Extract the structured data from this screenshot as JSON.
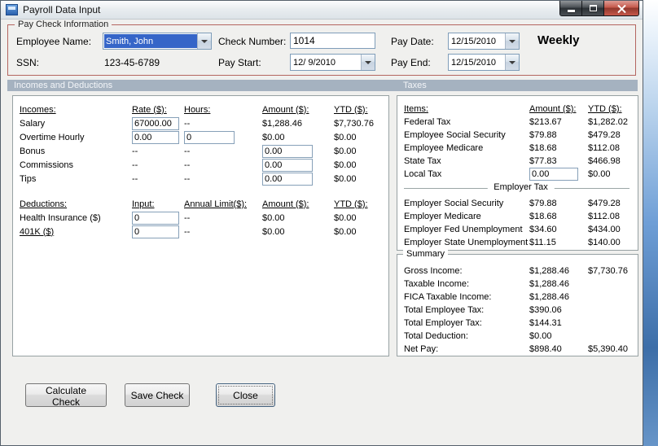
{
  "window": {
    "title": "Payroll Data Input"
  },
  "paycheck": {
    "group_label": "Pay Check Information",
    "fields": {
      "employee_name": {
        "label": "Employee Name:",
        "value": "Smith, John"
      },
      "ssn": {
        "label": "SSN:",
        "value": "123-45-6789"
      },
      "check_number": {
        "label": "Check Number:",
        "value": "1014"
      },
      "pay_start": {
        "label": "Pay Start:",
        "value": "12/ 9/2010"
      },
      "pay_date": {
        "label": "Pay Date:",
        "value": "12/15/2010"
      },
      "pay_end": {
        "label": "Pay End:",
        "value": "12/15/2010"
      }
    },
    "frequency": "Weekly"
  },
  "section_headers": {
    "left": "Incomes and Deductions",
    "right": "Taxes"
  },
  "incomes": {
    "headers": {
      "item": "Incomes:",
      "rate": "Rate ($):",
      "hours": "Hours:",
      "amount": "Amount ($):",
      "ytd": "YTD ($):"
    },
    "salary": {
      "label": "Salary",
      "rate_input": "67000.00",
      "hours": "--",
      "amount": "$1,288.46",
      "ytd": "$7,730.76"
    },
    "overtime": {
      "label": "Overtime Hourly",
      "rate_input": "0.00",
      "hours_input": "0",
      "amount": "$0.00",
      "ytd": "$0.00"
    },
    "bonus": {
      "label": "Bonus",
      "rate": "--",
      "hours": "--",
      "amount_input": "0.00",
      "ytd": "$0.00"
    },
    "commissions": {
      "label": "Commissions",
      "rate": "--",
      "hours": "--",
      "amount_input": "0.00",
      "ytd": "$0.00"
    },
    "tips": {
      "label": "Tips",
      "rate": "--",
      "hours": "--",
      "amount_input": "0.00",
      "ytd": "$0.00"
    }
  },
  "deductions": {
    "headers": {
      "item": "Deductions:",
      "input": "Input:",
      "limit": "Annual Limit($):",
      "amount": "Amount ($):",
      "ytd": "YTD ($):"
    },
    "health": {
      "label": "Health Insurance  ($)",
      "input": "0",
      "limit": "--",
      "amount": "$0.00",
      "ytd": "$0.00"
    },
    "k401": {
      "label": "401K  ($)",
      "input": "0",
      "limit": "--",
      "amount": "$0.00",
      "ytd": "$0.00"
    }
  },
  "taxes": {
    "headers": {
      "item": "Items:",
      "amount": "Amount ($):",
      "ytd": "YTD ($):"
    },
    "rows": [
      {
        "label": "Federal Tax",
        "amount": "$213.67",
        "ytd": "$1,282.02"
      },
      {
        "label": "Employee Social Security",
        "amount": "$79.88",
        "ytd": "$479.28"
      },
      {
        "label": "Employee Medicare",
        "amount": "$18.68",
        "ytd": "$112.08"
      },
      {
        "label": "State Tax",
        "amount": "$77.83",
        "ytd": "$466.98"
      }
    ],
    "local_tax": {
      "label": "Local Tax",
      "amount_input": "0.00",
      "ytd": "$0.00"
    },
    "employer_label": "Employer Tax",
    "employer_rows": [
      {
        "label": "Employer Social Security",
        "amount": "$79.88",
        "ytd": "$479.28"
      },
      {
        "label": "Employer Medicare",
        "amount": "$18.68",
        "ytd": "$112.08"
      },
      {
        "label": "Employer Fed Unemployment",
        "amount": "$34.60",
        "ytd": "$434.00"
      },
      {
        "label": "Employer State Unemployment",
        "amount": "$11.15",
        "ytd": "$140.00"
      }
    ]
  },
  "summary": {
    "group_label": "Summary",
    "rows": [
      {
        "label": "Gross Income:",
        "amount": "$1,288.46",
        "ytd": "$7,730.76"
      },
      {
        "label": "Taxable Income:",
        "amount": "$1,288.46",
        "ytd": ""
      },
      {
        "label": "FICA Taxable Income:",
        "amount": "$1,288.46",
        "ytd": ""
      },
      {
        "label": "Total Employee Tax:",
        "amount": "$390.06",
        "ytd": ""
      },
      {
        "label": "Total Employer Tax:",
        "amount": "$144.31",
        "ytd": ""
      },
      {
        "label": "Total Deduction:",
        "amount": "$0.00",
        "ytd": ""
      },
      {
        "label": "Net Pay:",
        "amount": "$898.40",
        "ytd": "$5,390.40"
      }
    ]
  },
  "buttons": {
    "calculate": "Calculate Check",
    "save": "Save Check",
    "close": "Close"
  },
  "colors": {
    "group_border": "#b4655f",
    "band": "#a5b2c0",
    "selection": "#3565c8",
    "close_button": "#c14a3c"
  }
}
